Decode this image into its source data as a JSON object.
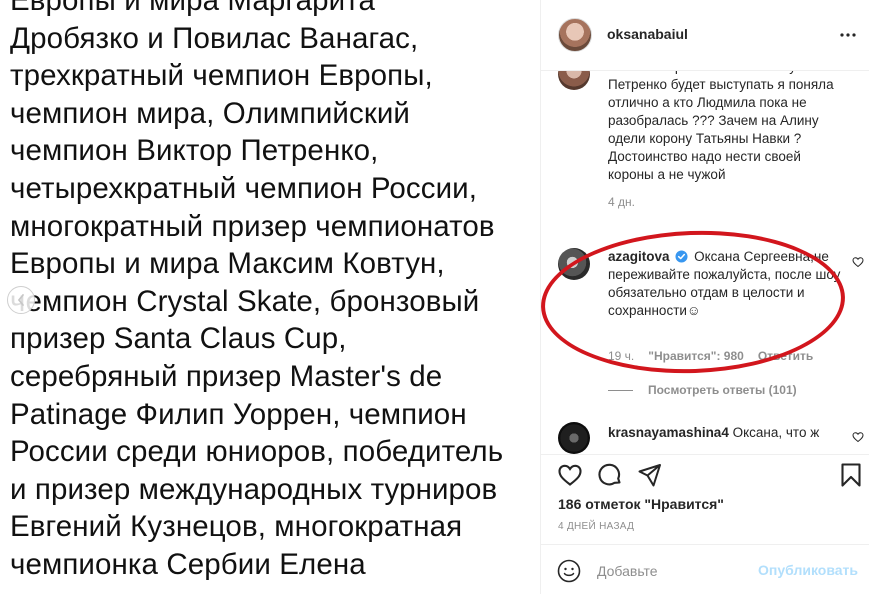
{
  "post_image": {
    "lines": [
      "Европы и мира Маргарита",
      "Дробязко и Повилас Ванагас,",
      "трехкратный чемпион Европы,",
      "чемпион мира, Олимпийский",
      "чемпион Виктор Петренко,",
      "четырехкратный чемпион России,",
      "многократный призер чемпионатов",
      "Европы и мира Максим Ковтун,",
      "чемпион Crystal Skate, бронзовый",
      "призер Santa Claus Cup,",
      "серебряный призер Master's de",
      "Patinage Филип Уоррен, чемпион",
      "России среди юниоров, победитель",
      "и призер международных турниров",
      "Евгений Кузнецов, многократная",
      "чемпионка Сербии Елена"
    ]
  },
  "header": {
    "username": "oksanabaiul"
  },
  "comments": [
    {
      "text": "такая интересная ? Что в шоу Навки Петренко будет выступать я поняла отлично а кто Людмила пока не разобралась ??? Зачем на Алину одели корону Татьяны Навки ? Достоинство надо нести своей короны а не чужой",
      "time": "4 дн."
    },
    {
      "username": "azagitova",
      "text": "Оксана Сергеевна,не переживайте пожалуйста, после шоу обязательно отдам в целости и сохранности☺",
      "time": "19 ч.",
      "likes": "\"Нравится\": 980",
      "reply": "Ответить",
      "view_replies": "Посмотреть ответы (101)"
    },
    {
      "username": "krasnayamashina4",
      "text": "Оксана, что ж"
    }
  ],
  "footer": {
    "likes": "186 отметок \"Нравится\"",
    "date": "4 ДНЕЙ НАЗАД",
    "comment_placeholder": "Добавьте",
    "publish_label": "Опубликовать"
  },
  "colors": {
    "highlight_ring": "#d2161d",
    "verified_badge": "#3897f0",
    "publish_disabled": "#b2dffc"
  }
}
